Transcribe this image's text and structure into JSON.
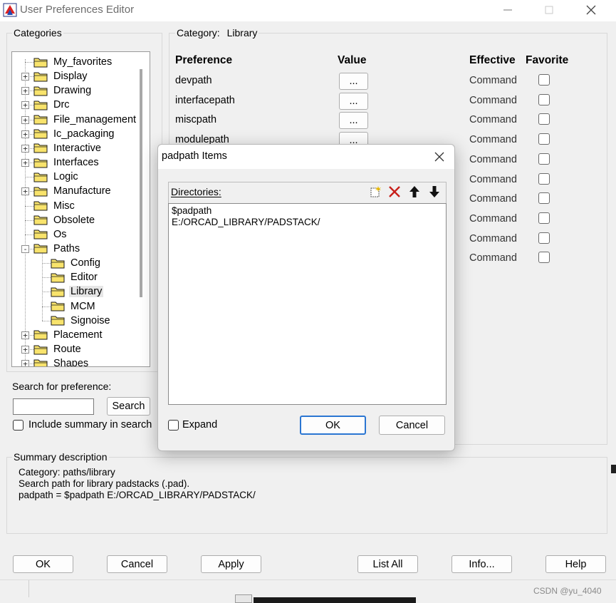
{
  "window": {
    "title": "User Preferences Editor"
  },
  "categories": {
    "label": "Categories",
    "items": [
      {
        "label": "My_favorites",
        "level": 0,
        "expander": ""
      },
      {
        "label": "Display",
        "level": 0,
        "expander": "+"
      },
      {
        "label": "Drawing",
        "level": 0,
        "expander": "+"
      },
      {
        "label": "Drc",
        "level": 0,
        "expander": "+"
      },
      {
        "label": "File_management",
        "level": 0,
        "expander": "+"
      },
      {
        "label": "Ic_packaging",
        "level": 0,
        "expander": "+"
      },
      {
        "label": "Interactive",
        "level": 0,
        "expander": "+"
      },
      {
        "label": "Interfaces",
        "level": 0,
        "expander": "+"
      },
      {
        "label": "Logic",
        "level": 0,
        "expander": ""
      },
      {
        "label": "Manufacture",
        "level": 0,
        "expander": "+"
      },
      {
        "label": "Misc",
        "level": 0,
        "expander": ""
      },
      {
        "label": "Obsolete",
        "level": 0,
        "expander": ""
      },
      {
        "label": "Os",
        "level": 0,
        "expander": ""
      },
      {
        "label": "Paths",
        "level": 0,
        "expander": "−"
      },
      {
        "label": "Config",
        "level": 1,
        "expander": ""
      },
      {
        "label": "Editor",
        "level": 1,
        "expander": ""
      },
      {
        "label": "Library",
        "level": 1,
        "expander": "",
        "selected": true
      },
      {
        "label": "MCM",
        "level": 1,
        "expander": ""
      },
      {
        "label": "Signoise",
        "level": 1,
        "expander": ""
      },
      {
        "label": "Placement",
        "level": 0,
        "expander": "+"
      },
      {
        "label": "Route",
        "level": 0,
        "expander": "+"
      },
      {
        "label": "Shapes",
        "level": 0,
        "expander": "+"
      }
    ]
  },
  "search": {
    "label": "Search for preference:",
    "value": "",
    "button": "Search",
    "include_summary": "Include summary in search"
  },
  "category_panel": {
    "category_label": "Category:",
    "category_value": "Library",
    "columns": {
      "preference": "Preference",
      "value": "Value",
      "effective": "Effective",
      "favorite": "Favorite"
    },
    "rows": [
      {
        "name": "devpath",
        "value_btn": "...",
        "effective": "Command"
      },
      {
        "name": "interfacepath",
        "value_btn": "...",
        "effective": "Command"
      },
      {
        "name": "miscpath",
        "value_btn": "...",
        "effective": "Command"
      },
      {
        "name": "modulepath",
        "value_btn": "...",
        "effective": "Command"
      },
      {
        "name": "",
        "value_btn": "",
        "effective": "Command"
      },
      {
        "name": "",
        "value_btn": "",
        "effective": "Command"
      },
      {
        "name": "",
        "value_btn": "",
        "effective": "Command"
      },
      {
        "name": "",
        "value_btn": "",
        "effective": "Command"
      },
      {
        "name": "",
        "value_btn": "",
        "effective": "Command"
      },
      {
        "name": "",
        "value_btn": "",
        "effective": "Command"
      }
    ]
  },
  "summary": {
    "label": "Summary description",
    "lines": [
      "Category: paths/library",
      "Search path for library padstacks (.pad).",
      "padpath = $padpath E:/ORCAD_LIBRARY/PADSTACK/"
    ]
  },
  "bottom_buttons": {
    "ok": "OK",
    "cancel": "Cancel",
    "apply": "Apply",
    "list_all": "List All",
    "info": "Info...",
    "help": "Help"
  },
  "dialog": {
    "title": "padpath Items",
    "directories_label": "Directories:",
    "directories": [
      "$padpath",
      "E:/ORCAD_LIBRARY/PADSTACK/"
    ],
    "expand_label": "Expand",
    "ok": "OK",
    "cancel": "Cancel"
  },
  "watermark": "CSDN @yu_4040"
}
